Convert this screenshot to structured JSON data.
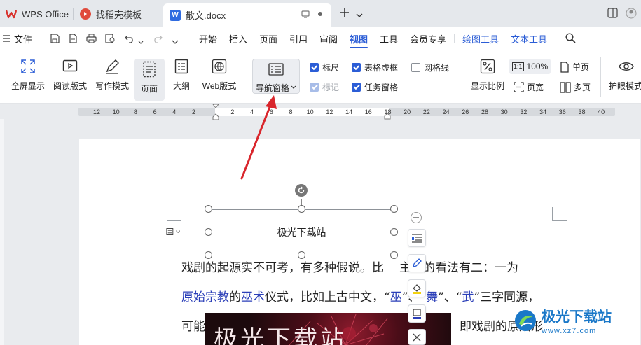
{
  "tabs": [
    {
      "label": "WPS Office",
      "icon": "wps-logo-icon"
    },
    {
      "label": "找稻壳模板",
      "icon": "docer-icon"
    },
    {
      "label": "散文.docx",
      "icon": "word-doc-icon"
    }
  ],
  "menu": {
    "file_label": "文件",
    "items": [
      "开始",
      "插入",
      "页面",
      "引用",
      "审阅",
      "视图",
      "工具",
      "会员专享"
    ],
    "active": "视图",
    "context_tools": [
      "绘图工具",
      "文本工具"
    ]
  },
  "ribbon": {
    "buttons": [
      "全屏显示",
      "阅读版式",
      "写作模式",
      "页面",
      "大纲",
      "Web版式"
    ],
    "nav_pane_label": "导航窗格",
    "checkboxes": [
      {
        "label": "标尺",
        "checked": true,
        "disabled": false
      },
      {
        "label": "表格虚框",
        "checked": true,
        "disabled": false
      },
      {
        "label": "网格线",
        "checked": false,
        "disabled": false
      },
      {
        "label": "标记",
        "checked": true,
        "disabled": true
      },
      {
        "label": "任务窗格",
        "checked": true,
        "disabled": false
      }
    ],
    "display_ratio_label": "显示比例",
    "zoom_value": "100%",
    "page_width_label": "页宽",
    "single_page_label": "单页",
    "multi_page_label": "多页",
    "eye_protect_label": "护眼模式"
  },
  "ruler": {
    "numbers": [
      "12",
      "10",
      "8",
      "6",
      "4",
      "2",
      "",
      "2",
      "4",
      "6",
      "8",
      "10",
      "12",
      "14",
      "16",
      "18",
      "20",
      "22",
      "24",
      "26",
      "28",
      "30",
      "32",
      "34",
      "36",
      "38",
      "40"
    ]
  },
  "document": {
    "textbox_text": "极光下载站",
    "line1": "戏剧的起源实不可考，有多种假说。比",
    "line1_tail": "主流的看法有二：一为",
    "line2_link1": "原始宗教",
    "line2_mid1": "的",
    "line2_link2": "巫术",
    "line2_mid2": "仪式，比如上古中文，“",
    "line2_link3": "巫",
    "line2_mid3": "”、“",
    "line2_link4": "舞",
    "line2_mid4": "”、“",
    "line2_link5": "武",
    "line2_tail": "”三字同源，",
    "line3_head": "可能",
    "line3_tail": "即戏剧的原始形",
    "image_text": "极光下载站"
  },
  "watermark": {
    "title": "极光下载站",
    "url": "www.xz7.com"
  }
}
